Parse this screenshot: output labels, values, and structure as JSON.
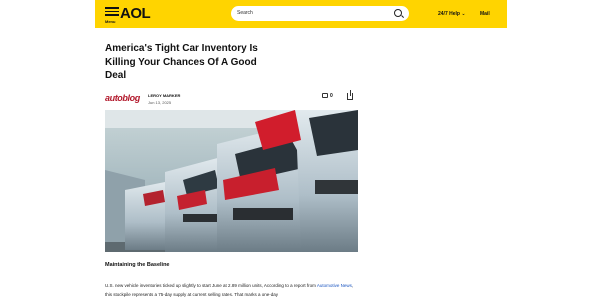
{
  "header": {
    "menu_label": "Menu",
    "logo": "AOL",
    "search_placeholder": "Search",
    "help": "24/7 Help",
    "help_chevron": "⌄",
    "mail": "Mail"
  },
  "article": {
    "title": "America's Tight Car Inventory Is Killing Your Chances Of A Good Deal",
    "source": "autoblog",
    "author": "LEROY MARKER",
    "date": "Jun 13, 2025",
    "comments_count": "0",
    "subheading": "Maintaining the Baseline",
    "paragraph_line1": "U.S. new vehicle inventories ticked up slightly to start June at 2.89 million units, According to a report from",
    "paragraph_link": "Automotive News",
    "paragraph_line2_rest": ", this stockpile represents a 75-day supply at current selling rates. That marks a one-day"
  },
  "colors": {
    "brand_yellow": "#ffd400",
    "source_red": "#b2182b",
    "link_blue": "#1a55c0"
  },
  "icons": [
    "menu-icon",
    "search-icon",
    "chevron-down-icon",
    "comment-icon",
    "share-icon"
  ]
}
